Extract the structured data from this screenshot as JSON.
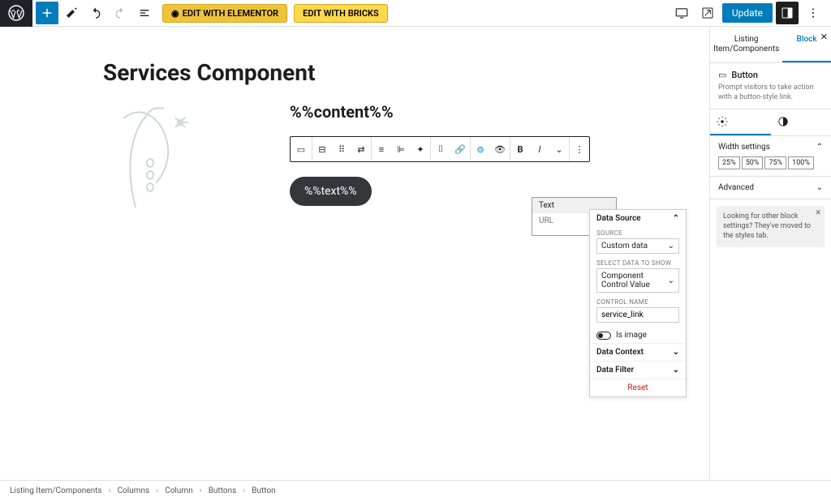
{
  "topbar": {
    "edit_elementor": "EDIT WITH ELEMENTOR",
    "edit_bricks": "EDIT WITH BRICKS",
    "update": "Update"
  },
  "page": {
    "title": "Services Component",
    "content_token": "%%content%%",
    "button_text": "%%text%%"
  },
  "link_popover": {
    "text": "Text",
    "url": "URL"
  },
  "popover": {
    "data_source": "Data Source",
    "source": "SOURCE",
    "source_val": "Custom data",
    "select_data": "SELECT DATA TO SHOW",
    "select_val": "Component Control Value",
    "control_name": "CONTROL NAME",
    "control_val": "service_link",
    "is_image": "Is image",
    "data_context": "Data Context",
    "data_filter": "Data Filter",
    "reset": "Reset"
  },
  "sidebar": {
    "tab1": "Listing Item/Components",
    "tab2": "Block",
    "block_name": "Button",
    "block_desc": "Prompt visitors to take action with a button-style link.",
    "width_settings": "Width settings",
    "widths": [
      "25%",
      "50%",
      "75%",
      "100%"
    ],
    "advanced": "Advanced",
    "notice": "Looking for other block settings? They've moved to the styles tab."
  },
  "breadcrumb": [
    "Listing Item/Components",
    "Columns",
    "Column",
    "Buttons",
    "Button"
  ]
}
